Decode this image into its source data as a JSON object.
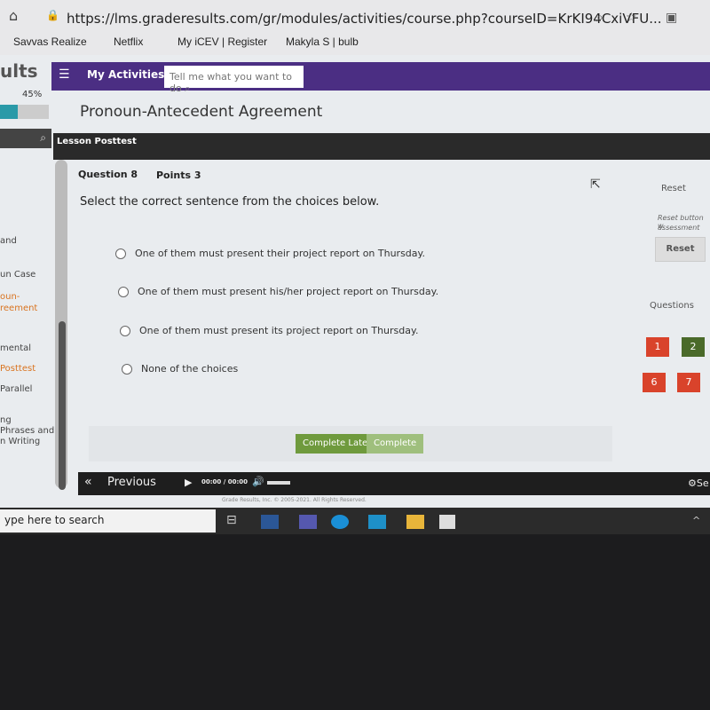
{
  "browser": {
    "url": "https://lms.graderesults.com/gr/modules/activities/course.php?courseID=KrKI94CxiVFU...",
    "bookmarks": [
      "Savvas Realize",
      "Netflix",
      "My iCEV | Register",
      "Makyla S | bulb"
    ]
  },
  "app": {
    "logo": "ults",
    "nav_label": "My Activities",
    "search_placeholder": "Tell me what you want to do",
    "progress_text": "45%",
    "progress_value": 45,
    "title": "Pronoun-Antecedent Agreement",
    "lesson_label": "Lesson Posttest",
    "sidebar": [
      "and",
      "un Case",
      "oun-",
      "reement",
      "mental",
      "Posttest",
      "Parallel",
      "ng",
      "Phrases and",
      "n Writing"
    ]
  },
  "question": {
    "number": "Question 8",
    "points": "Points 3",
    "prompt": "Select the correct sentence from the choices below.",
    "options": [
      "One of them must present their project report on Thursday.",
      "One of them must present his/her project report on Thursday.",
      "One of them must present its project report on Thursday.",
      "None of the choices"
    ]
  },
  "right": {
    "reset_heading": "Reset",
    "reset_note_1": "Reset button w",
    "reset_note_2": "assessment",
    "reset_button": "Reset",
    "questions_label": "Questions",
    "question_buttons": [
      {
        "n": "1",
        "color": "#d9432b"
      },
      {
        "n": "2",
        "color": "#4a6a2a"
      },
      {
        "n": "6",
        "color": "#d9432b"
      },
      {
        "n": "7",
        "color": "#d9432b"
      }
    ]
  },
  "actions": {
    "complete_later": "Complete Later",
    "complete": "Complete"
  },
  "footer": {
    "previous": "Previous",
    "time": "00:00 / 00:00",
    "settings": "Se",
    "copyright": "Grade Results, Inc. © 2005-2021. All Rights Reserved."
  },
  "taskbar": {
    "search": "ype here to search"
  }
}
